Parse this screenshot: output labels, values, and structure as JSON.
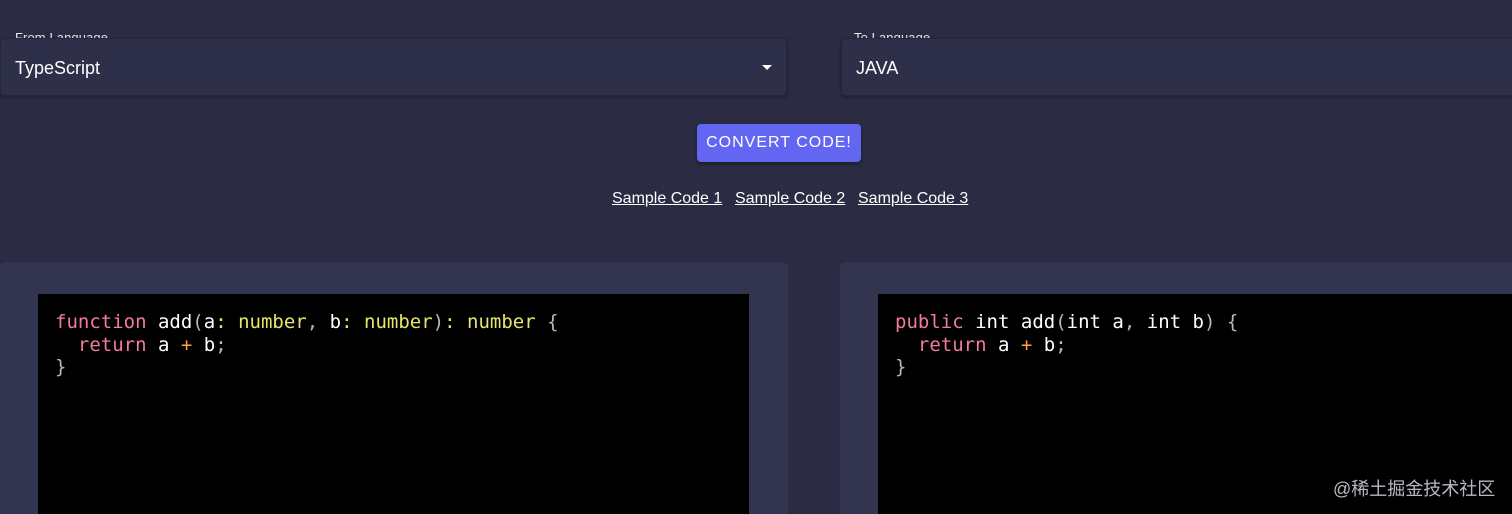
{
  "from_language": {
    "label": "From Language",
    "value": "TypeScript"
  },
  "to_language": {
    "label": "To Language",
    "value": "JAVA"
  },
  "convert_button": {
    "label": "CONVERT CODE!",
    "color": "#6366f1"
  },
  "sample_links": [
    {
      "label": "Sample Code 1"
    },
    {
      "label": "Sample Code 2"
    },
    {
      "label": "Sample Code 3"
    }
  ],
  "source_code": {
    "lines": [
      [
        {
          "t": "function",
          "k": "keyword"
        },
        {
          "t": " ",
          "k": "ident"
        },
        {
          "t": "add",
          "k": "func"
        },
        {
          "t": "(",
          "k": "punct"
        },
        {
          "t": "a",
          "k": "ident"
        },
        {
          "t": ":",
          "k": "colon"
        },
        {
          "t": " ",
          "k": "ident"
        },
        {
          "t": "number",
          "k": "type"
        },
        {
          "t": ",",
          "k": "punct"
        },
        {
          "t": " ",
          "k": "ident"
        },
        {
          "t": "b",
          "k": "ident"
        },
        {
          "t": ":",
          "k": "colon"
        },
        {
          "t": " ",
          "k": "ident"
        },
        {
          "t": "number",
          "k": "type"
        },
        {
          "t": ")",
          "k": "punct"
        },
        {
          "t": ":",
          "k": "colon"
        },
        {
          "t": " ",
          "k": "ident"
        },
        {
          "t": "number",
          "k": "type"
        },
        {
          "t": " ",
          "k": "ident"
        },
        {
          "t": "{",
          "k": "punct"
        }
      ],
      [
        {
          "t": "  ",
          "k": "ident"
        },
        {
          "t": "return",
          "k": "keyword"
        },
        {
          "t": " a ",
          "k": "ident"
        },
        {
          "t": "+",
          "k": "op"
        },
        {
          "t": " b",
          "k": "ident"
        },
        {
          "t": ";",
          "k": "punct"
        }
      ],
      [
        {
          "t": "}",
          "k": "punct"
        }
      ]
    ]
  },
  "target_code": {
    "lines": [
      [
        {
          "t": "public",
          "k": "keyword"
        },
        {
          "t": " ",
          "k": "ident"
        },
        {
          "t": "int",
          "k": "ident"
        },
        {
          "t": " ",
          "k": "ident"
        },
        {
          "t": "add",
          "k": "func"
        },
        {
          "t": "(",
          "k": "punct"
        },
        {
          "t": "int",
          "k": "ident"
        },
        {
          "t": " a",
          "k": "ident"
        },
        {
          "t": ",",
          "k": "punct"
        },
        {
          "t": " ",
          "k": "ident"
        },
        {
          "t": "int",
          "k": "ident"
        },
        {
          "t": " b",
          "k": "ident"
        },
        {
          "t": ")",
          "k": "punct"
        },
        {
          "t": " ",
          "k": "ident"
        },
        {
          "t": "{",
          "k": "punct"
        }
      ],
      [
        {
          "t": "  ",
          "k": "ident"
        },
        {
          "t": "return",
          "k": "keyword"
        },
        {
          "t": " a ",
          "k": "ident"
        },
        {
          "t": "+",
          "k": "op"
        },
        {
          "t": " b",
          "k": "ident"
        },
        {
          "t": ";",
          "k": "punct"
        }
      ],
      [
        {
          "t": "}",
          "k": "punct"
        }
      ]
    ]
  },
  "watermark": "@稀土掘金技术社区",
  "colors": {
    "background": "#2b2c43",
    "panel": "#33344f",
    "editor_background": "#000000",
    "keyword": "#f27b9a",
    "type": "#e6e66a",
    "operator": "#ffa33a"
  }
}
